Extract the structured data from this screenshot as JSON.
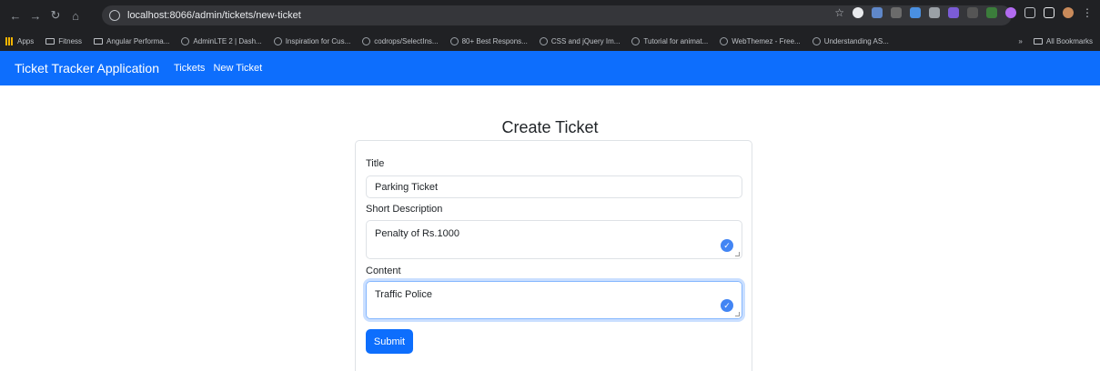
{
  "browser": {
    "url": "localhost:8066/admin/tickets/new-ticket",
    "bookmarks": [
      {
        "label": "Apps",
        "kind": "apps"
      },
      {
        "label": "Fitness",
        "kind": "folder"
      },
      {
        "label": "Angular Performa...",
        "kind": "folder"
      },
      {
        "label": "AdminLTE 2 | Dash...",
        "kind": "site"
      },
      {
        "label": "Inspiration for Cus...",
        "kind": "site"
      },
      {
        "label": "codrops/SelectIns...",
        "kind": "site"
      },
      {
        "label": "80+ Best Respons...",
        "kind": "site"
      },
      {
        "label": "CSS and jQuery Im...",
        "kind": "site"
      },
      {
        "label": "Tutorial for animat...",
        "kind": "site"
      },
      {
        "label": "WebThemez - Free...",
        "kind": "site"
      },
      {
        "label": "Understanding AS...",
        "kind": "site"
      }
    ],
    "bookmarks_more": "»",
    "all_bookmarks": "All Bookmarks"
  },
  "navbar": {
    "brand": "Ticket Tracker Application",
    "links": [
      "Tickets",
      "New Ticket"
    ],
    "color": "#0d6efd"
  },
  "page": {
    "title": "Create Ticket"
  },
  "form": {
    "title_label": "Title",
    "title_value": "Parking Ticket",
    "short_description_label": "Short Description",
    "short_description_value": "Penalty of Rs.1000",
    "content_label": "Content",
    "content_value": "Traffic Police",
    "submit_label": "Submit"
  }
}
